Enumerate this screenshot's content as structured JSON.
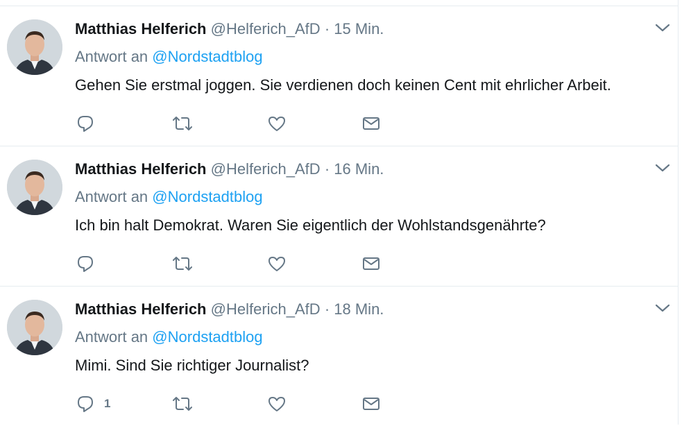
{
  "tweets": [
    {
      "name": "Matthias Helferich",
      "handle": "@Helferich_AfD",
      "dot": "·",
      "time": "15 Min.",
      "reply_prefix": "Antwort an",
      "reply_mention": "@Nordstadtblog",
      "text": "Gehen Sie erstmal joggen. Sie verdienen doch keinen Cent mit ehrlicher Arbeit.",
      "reply_count": ""
    },
    {
      "name": "Matthias Helferich",
      "handle": "@Helferich_AfD",
      "dot": "·",
      "time": "16 Min.",
      "reply_prefix": "Antwort an",
      "reply_mention": "@Nordstadtblog",
      "text": "Ich bin halt Demokrat. Waren Sie eigentlich der Wohlstandsgenährte?",
      "reply_count": ""
    },
    {
      "name": "Matthias Helferich",
      "handle": "@Helferich_AfD",
      "dot": "·",
      "time": "18 Min.",
      "reply_prefix": "Antwort an",
      "reply_mention": "@Nordstadtblog",
      "text": "Mimi. Sind Sie richtiger Journalist?",
      "reply_count": "1"
    }
  ],
  "colors": {
    "name": "#14171a",
    "meta": "#657786",
    "mention": "#1da1f2",
    "icon": "#657786",
    "border": "#e6ecf0"
  },
  "icons": [
    "reply-icon",
    "retweet-icon",
    "like-icon",
    "direct-message-icon",
    "chevron-down-icon"
  ]
}
